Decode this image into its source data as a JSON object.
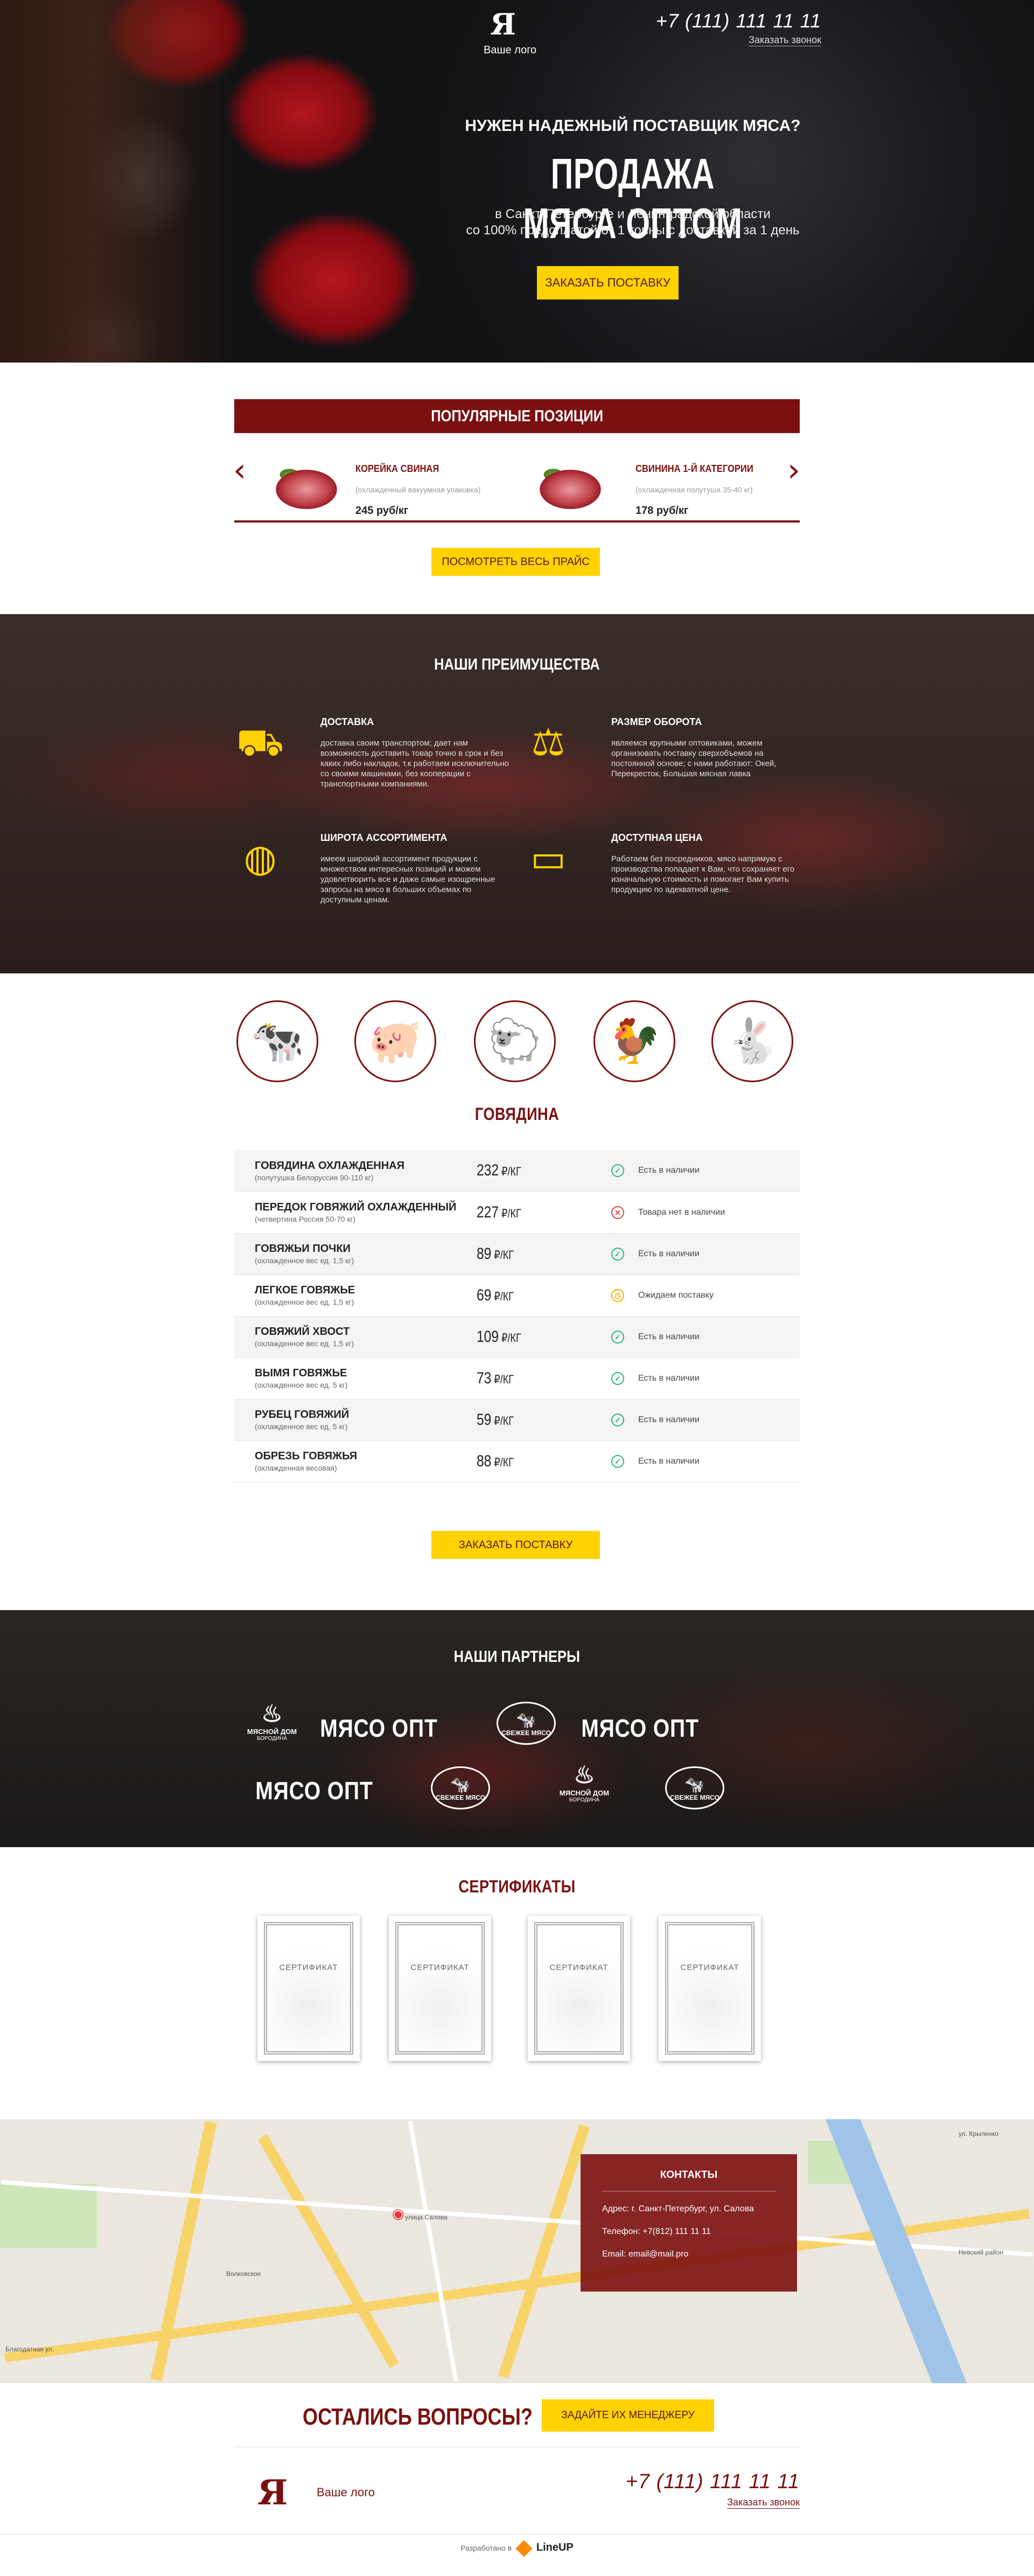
{
  "hero": {
    "logo_text": "Ваше лого",
    "phone": "+7 (111) 111 11 11",
    "call_link": "Заказать звонок",
    "tagline": "НУЖЕН НАДЕЖНЫЙ ПОСТАВЩИК МЯСА?",
    "title": "ПРОДАЖА МЯСА ОПТОМ",
    "subtitle_line1": "в Санкт-Петербурге и Ленинградской области",
    "subtitle_line2": "со 100% предоплатой от 1 тонны с доставкой за 1 день",
    "button": "ЗАКАЗАТЬ ПОСТАВКУ"
  },
  "popular": {
    "title": "ПОПУЛЯРНЫЕ ПОЗИЦИИ",
    "items": [
      {
        "name": "КОРЕЙКА СВИНАЯ",
        "desc": "(охлажденный вакуумная упаковка)",
        "price": "245 руб/кг"
      },
      {
        "name": "СВИНИНА 1-Й КАТЕГОРИИ",
        "desc": "(охлажденная полутуша 35-40 кг)",
        "price": "178 руб/кг"
      }
    ],
    "button": "ПОСМОТРЕТЬ ВЕСЬ ПРАЙС"
  },
  "advantages": {
    "title": "НАШИ ПРЕИМУЩЕСТВА",
    "items": [
      {
        "name": "ДОСТАВКА",
        "icon": "truck-icon",
        "desc": "доставка своим транспортом; дает нам возможность доставить товар точно в срок и без каких либо накладок, т.к работаем исключительно со своими машинами, без кооперации с транспортными компаниями."
      },
      {
        "name": "РАЗМЕР ОБОРОТА",
        "icon": "hand-truck-icon",
        "desc": "являемся крупными оптовиками, можем организовать поставку сверхобъемов на постоянной основе; с нами работают: Окей, Перекресток, Большая мясная лавка"
      },
      {
        "name": "ШИРОТА АССОРТИМЕНТА",
        "icon": "steak-icon",
        "desc": "имеем широкий ассортимент продукции с множеством интересных позиций и можем удовлетворить все и даже самые изощренные запросы на мясо в больших объемах по доступным ценам."
      },
      {
        "name": "ДОСТУПНАЯ ЦЕНА",
        "icon": "card-hand-icon",
        "desc": "Работаем без посредников, мясо напрямую с производства попадает к Вам, что сохраняет его изначальную стоимость и помогает Вам купить продукцию по адекватной цене."
      }
    ]
  },
  "catalog": {
    "categories": [
      "cow-icon",
      "pig-icon",
      "sheep-icon",
      "chicken-icon",
      "rabbit-icon"
    ],
    "title": "ГОВЯДИНА",
    "unit": "₽/КГ",
    "rows": [
      {
        "name": "ГОВЯДИНА ОХЛАЖДЕННАЯ",
        "desc": "(полутушка Белоруссия 90-110 кг)",
        "price": "232",
        "status": "Есть в наличии",
        "state": "ok"
      },
      {
        "name": "ПЕРЕДОК ГОВЯЖИЙ ОХЛАЖДЕННЫЙ",
        "desc": "(четвертина Россия 50-70 кг)",
        "price": "227",
        "status": "Товара нет в наличии",
        "state": "no"
      },
      {
        "name": "ГОВЯЖЬИ ПОЧКИ",
        "desc": "(охлажденное вес ед. 1,5 кг)",
        "price": "89",
        "status": "Есть в наличии",
        "state": "ok"
      },
      {
        "name": "ЛЕГКОЕ ГОВЯЖЬЕ",
        "desc": "(охлажденное вес ед. 1,5 кг)",
        "price": "69",
        "status": "Ожидаем поставку",
        "state": "wait"
      },
      {
        "name": "ГОВЯЖИЙ ХВОСТ",
        "desc": "(охлажденное вес ед. 1,5 кг)",
        "price": "109",
        "status": "Есть в наличии",
        "state": "ok"
      },
      {
        "name": "ВЫМЯ ГОВЯЖЬЕ",
        "desc": "(охлажденное вес ед. 5 кг)",
        "price": "73",
        "status": "Есть в наличии",
        "state": "ok"
      },
      {
        "name": "РУБЕЦ ГОВЯЖИЙ",
        "desc": "(охлажденное вес ед. 5 кг)",
        "price": "59",
        "status": "Есть в наличии",
        "state": "ok"
      },
      {
        "name": "ОБРЕЗЬ ГОВЯЖЬЯ",
        "desc": "(охлажденная весовая)",
        "price": "88",
        "status": "Есть в наличии",
        "state": "ok"
      }
    ],
    "button": "ЗАКАЗАТЬ ПОСТАВКУ"
  },
  "partners": {
    "title": "НАШИ ПАРТНЕРЫ",
    "logo_myaso_opt": "МЯСО  ОПТ",
    "logo_dom_1": "МЯСНОЙ ДОМ",
    "logo_dom_2": "БОРОДИНА",
    "logo_fresh": "СВЕЖЕЕ МЯСО"
  },
  "certificates": {
    "title": "СЕРТИФИКАТЫ",
    "label": "СЕРТИФИКАТ"
  },
  "map": {
    "labels": [
      "улица Салова",
      "Волковское",
      "Благодатная ул.",
      "Невский район",
      "ул. Крыленко"
    ]
  },
  "contacts": {
    "title": "КОНТАКТЫ",
    "address": "Адрес: г. Санкт-Петербург, ул. Салова",
    "phone": "Телефон: +7(812) 111 11 11",
    "email": "Email: email@mail.pro"
  },
  "questions": {
    "title": "ОСТАЛИСЬ ВОПРОСЫ?",
    "button": "ЗАДАЙТЕ ИХ МЕНЕДЖЕРУ"
  },
  "footer": {
    "logo_text": "Ваше лого",
    "phone": "+7 (111) 111 11 11",
    "call_link": "Заказать звонок",
    "developed": "Разработано в",
    "brand": "LineUP"
  },
  "colors": {
    "accent": "#7b1010",
    "button": "#ffd200"
  }
}
